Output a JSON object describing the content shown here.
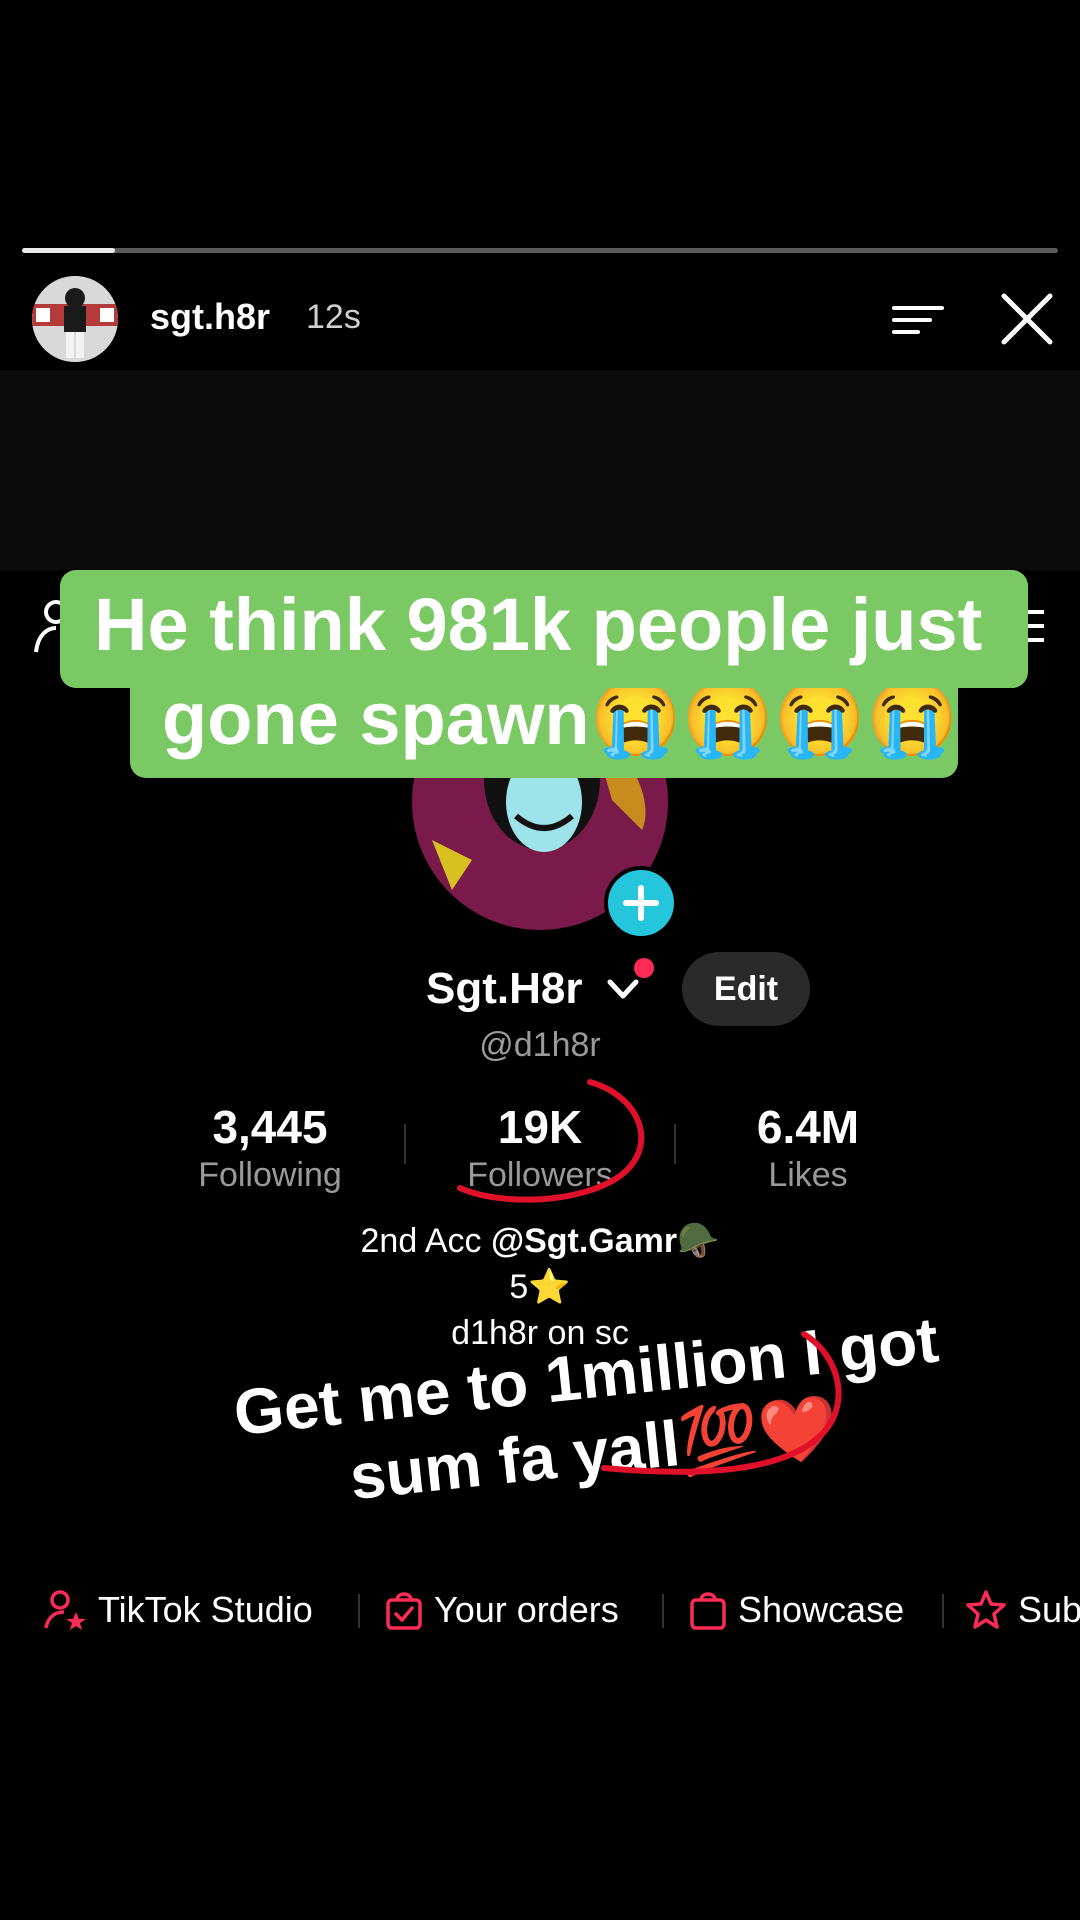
{
  "story": {
    "username": "sgt.h8r",
    "time_ago": "12s",
    "progress": 0.09
  },
  "caption": {
    "line1": "He think 981k people just",
    "line2": "gone spawn😭😭😭😭",
    "bg_color": "#7bc965"
  },
  "profile": {
    "display_name": "Sgt.H8r",
    "handle": "@d1h8r",
    "edit_label": "Edit",
    "stats": [
      {
        "value": "3,445",
        "label": "Following"
      },
      {
        "value": "19K",
        "label": "Followers"
      },
      {
        "value": "6.4M",
        "label": "Likes"
      }
    ],
    "bio": {
      "line1_prefix": "2nd Acc ",
      "line1_bold": "@Sgt.Gamr",
      "line1_emoji": "🪖",
      "line2": "5⭐",
      "line3": "d1h8r on sc"
    }
  },
  "overlay": {
    "line1": "Get me to 1million I got",
    "line2": "sum fa yall💯❤️"
  },
  "shortcuts": [
    {
      "label": "TikTok Studio",
      "icon": "studio-person-star-icon"
    },
    {
      "label": "Your orders",
      "icon": "orders-bag-icon"
    },
    {
      "label": "Showcase",
      "icon": "showcase-bag-icon"
    },
    {
      "label": "Sub",
      "icon": "subscription-star-icon"
    }
  ],
  "colors": {
    "accent_pink": "#fe2c55",
    "add_button": "#25c6dc",
    "annotation_red": "#e0102a"
  }
}
